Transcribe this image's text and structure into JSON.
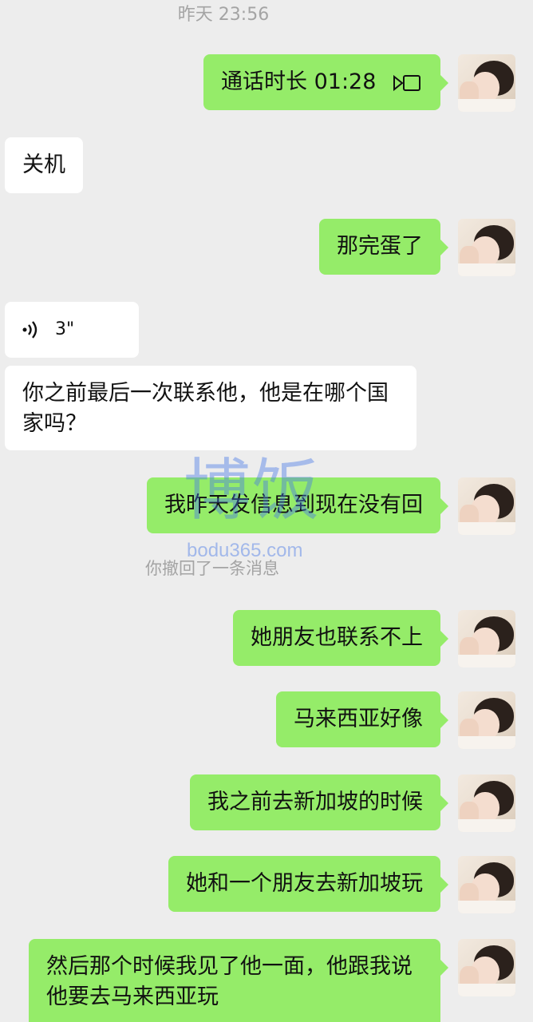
{
  "timestamp": "昨天 23:56",
  "messages": {
    "m1": "通话时长 01:28",
    "m2": "关机",
    "m3": "那完蛋了",
    "m4": "3\"",
    "m5": "你之前最后一次联系他，他是在哪个国家吗？",
    "m6": "我昨天发信息到现在没有回",
    "m7": "她朋友也联系不上",
    "m8": "马来西亚好像",
    "m9": "我之前去新加坡的时候",
    "m10": "她和一个朋友去新加坡玩",
    "m11": "然后那个时候我见了他一面，他跟我说他要去马来西亚玩"
  },
  "system_notice": "你撤回了一条消息",
  "watermark": {
    "main": "博饭",
    "site": "bodu365.com"
  },
  "colors": {
    "background": "#ededed",
    "outgoing_bubble": "#95ec69",
    "incoming_bubble": "#ffffff",
    "muted_text": "#a4a4a4"
  },
  "icons": {
    "call": "video-call-icon",
    "voice": "voice-wave-icon"
  }
}
